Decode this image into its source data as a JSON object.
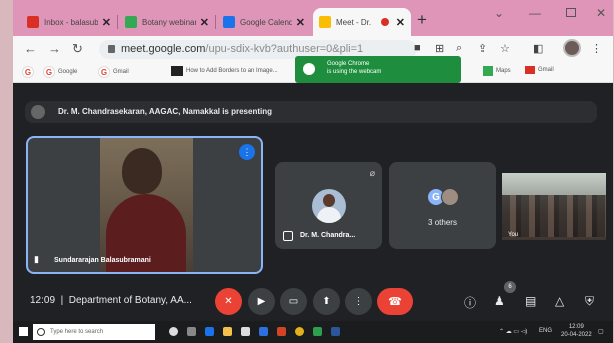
{
  "browser": {
    "tabs": [
      {
        "label": "Inbox - balasubramani",
        "favicon_color": "#d93025",
        "active": false
      },
      {
        "label": "Botany webinar",
        "favicon_color": "#34a853",
        "active": false
      },
      {
        "label": "Google Calendar",
        "favicon_color": "#1a73e8",
        "active": false
      },
      {
        "label": "Meet - Dr.",
        "favicon_color": "#fbbc04",
        "active": true
      }
    ],
    "url_host": "meet.google.com",
    "url_path": "/upu-sdix-kvb?authuser=0&pli=1",
    "bookmarks": [
      "Google",
      "Gmail",
      "How to Add Borders to an Image..."
    ],
    "bookmark_right": [
      "Maps",
      "Gmail"
    ],
    "toast": {
      "line1": "Google Chrome",
      "line2": "is using the webcam"
    }
  },
  "meet": {
    "presenting_text": "Dr. M. Chandrasekaran, AAGAC, Namakkal is presenting",
    "main_tile_name": "Sundararajan Balasubramani",
    "tile2_name": "Dr. M. Chandra...",
    "tile3_initial": "G",
    "tile3_text": "3 others",
    "tile4_name": "You",
    "clock": "12:09",
    "meeting_title": "Department of Botany, AA...",
    "participant_count": "6"
  },
  "taskbar": {
    "search_placeholder": "Type here to search",
    "time": "12:09",
    "date": "20-04-2022",
    "lang": "ENG"
  }
}
